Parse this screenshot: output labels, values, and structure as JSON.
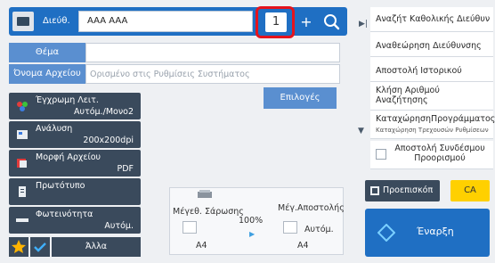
{
  "header": {
    "address_label": "Διεύθ.",
    "address_value": "AAA AAA",
    "count": "1",
    "plus": "+"
  },
  "form": {
    "subject_label": "Θέμα",
    "subject_value": "",
    "filename_label": "Όνομα Αρχείου",
    "filename_placeholder": "Ορισμένο στις Ρυθμίσεις Συστήματος"
  },
  "function_keys": [
    {
      "title": "Έγχρωμη Λειτ.",
      "value": "Αυτόμ./Μονο2"
    },
    {
      "title": "Ανάλυση",
      "value": "200x200dpi"
    },
    {
      "title": "Μορφή Αρχείου",
      "value": "PDF"
    },
    {
      "title": "Πρωτότυπο",
      "value": ""
    },
    {
      "title": "Φωτεινότητα",
      "value": "Αυτόμ."
    }
  ],
  "options_label": "Επιλογές",
  "preview": {
    "scan_size_label": "Μέγεθ. Σάρωσης",
    "send_size_label": "Μέγ.Αποστολής",
    "ratio": "100%",
    "scan_paper": "A4",
    "send_paper": "A4",
    "send_mode": "Αυτόμ."
  },
  "right_panel": {
    "items": [
      "Αναζήτ Καθολικής Διεύθυν",
      "Αναθεώρηση Διεύθυνσης",
      "Αποστολή Ιστορικού",
      "Κλήση Αριθμού Αναζήτησης",
      "ΚαταχώρησηΠρογράμματος",
      "Αποστολή Συνδέσμου Προορισμού"
    ],
    "register_subtext": "Καταχώρηση Τρεχουσών Ρυθμίσεων"
  },
  "buttons": {
    "preview": "Προεπισκόπ",
    "ca": "CA",
    "start": "Έναρξη",
    "other": "Άλλα"
  },
  "colors": {
    "accent": "#1f6fc3",
    "highlight": "#e5141d",
    "ca": "#ffd000",
    "function_key": "#3a4a5c"
  }
}
